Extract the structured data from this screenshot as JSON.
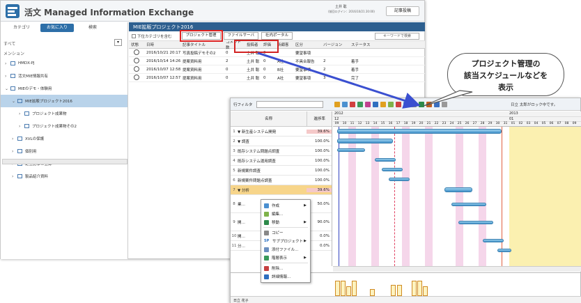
{
  "app": {
    "title": "活文 Managed Information Exchange",
    "user": "土井 聡",
    "login_info": "(前回ログイン：2016/10/21 20:00)",
    "post_button": "記事投稿"
  },
  "sidebar": {
    "tabs": [
      "カテゴリ",
      "お気に入り",
      "検索"
    ],
    "active_tab": 1,
    "filter": "すべて",
    "section": "メンション",
    "items": [
      {
        "label": "HMDX-PJ",
        "indent": 0,
        "arrow": "›"
      },
      {
        "label": "活文MIE情報共有",
        "indent": 0,
        "arrow": "›"
      },
      {
        "label": "MIEのデモ・体験用",
        "indent": 0,
        "arrow": "⌄"
      },
      {
        "label": "MIE拡販プロジェクト2016",
        "indent": 1,
        "arrow": "⌄"
      },
      {
        "label": "プロジェクト成果物",
        "indent": 2,
        "arrow": "›"
      },
      {
        "label": "プロジェクト成果物その2",
        "indent": 2,
        "arrow": "›"
      },
      {
        "label": "XVLの保護",
        "indent": 1,
        "arrow": "›"
      },
      {
        "label": "個別用",
        "indent": 1,
        "arrow": "›"
      },
      {
        "label": "定型記事の登録",
        "indent": 1,
        "arrow": "›"
      },
      {
        "label": "製品紹介資料",
        "indent": 1,
        "arrow": "›"
      }
    ],
    "selected": 3
  },
  "content": {
    "project_title": "MIE拡販プロジェクト2016",
    "include_sub": "下位カテゴリを含む",
    "buttons": [
      "プロジェクト管理",
      "ファイルサーバ",
      "社内ポータル"
    ],
    "search_placeholder": "キーワードで検索",
    "columns": [
      "状態",
      "日時",
      "記事タイトル",
      "コメント数",
      "投稿者",
      "評価",
      "新顧客",
      "区分",
      "バージョン",
      "ステータス"
    ],
    "rows": [
      [
        "2016/10/21 20:17",
        "写真投稿デモその2",
        "0",
        "土井 聡",
        "0",
        "",
        "要望事項",
        "",
        ""
      ],
      [
        "2016/10/14 14:26",
        "提案資料用",
        "2",
        "土井 聡",
        "0",
        "A社",
        "不具合報告",
        "2",
        "着手"
      ],
      [
        "2016/10/07 12:58",
        "提案資料用",
        "0",
        "土井 聡",
        "0",
        "B社",
        "要望事項",
        "2",
        "着手"
      ],
      [
        "2016/10/07 12:57",
        "提案資料用",
        "0",
        "土井 聡",
        "0",
        "A社",
        "要望事項",
        "3",
        "完了"
      ]
    ]
  },
  "callout": {
    "lines": [
      "プロジェクト管理の",
      "該当スケジュールなどを",
      "表示"
    ]
  },
  "gantt": {
    "filter_label": "行フィルタ",
    "lock_text": "日立 太郎がロック中です。",
    "col_name": "名称",
    "col_rate": "進捗率",
    "year1": "2012",
    "year2": "2013",
    "month1": "12",
    "month2": "01",
    "days": [
      "09",
      "10",
      "11",
      "12",
      "13",
      "14",
      "15",
      "16",
      "17",
      "18",
      "19",
      "20",
      "21",
      "22",
      "23",
      "24",
      "25",
      "26",
      "27",
      "28",
      "29",
      "30",
      "31",
      "01",
      "02",
      "03",
      "04",
      "05",
      "06",
      "07",
      "08",
      "09"
    ],
    "rows": [
      {
        "num": "1",
        "name": "▼ 新生産システム開発",
        "rate": "39.6%",
        "parent": true
      },
      {
        "num": "2",
        "name": "▼ 調査",
        "rate": "100.0%",
        "parent": false
      },
      {
        "num": "3",
        "name": "既存システム問題点調査",
        "rate": "100.0%",
        "parent": false
      },
      {
        "num": "4",
        "name": "既存システム運用調査",
        "rate": "100.0%",
        "parent": false
      },
      {
        "num": "5",
        "name": "新規案件調査",
        "rate": "100.0%",
        "parent": false
      },
      {
        "num": "6",
        "name": "新規案件問題点調査",
        "rate": "100.0%",
        "parent": false
      },
      {
        "num": "7",
        "name": "▼ 分析",
        "rate": "39.6%",
        "parent": true
      },
      {
        "num": "8",
        "name": "業…",
        "rate": "50.0%",
        "parent": false
      },
      {
        "num": "9",
        "name": "開…",
        "rate": "90.0%",
        "parent": false
      },
      {
        "num": "10",
        "name": "開…",
        "rate": "0.0%",
        "parent": false
      },
      {
        "num": "11",
        "name": "分…",
        "rate": "0.0%",
        "parent": false
      }
    ],
    "footer_user": "日立 花子"
  },
  "context_menu": {
    "items": [
      {
        "label": "作成",
        "icon_color": "#4a8fd0",
        "submenu": true
      },
      {
        "label": "編集...",
        "icon_color": "#7fb24a",
        "submenu": false
      },
      {
        "label": "移動",
        "icon_color": "#2d8a4a",
        "submenu": true
      },
      {
        "label": "コピー",
        "icon_color": "#888888",
        "submenu": false
      },
      {
        "label": "サブプロジェクト",
        "icon_color": "#2a6fc0",
        "submenu": true,
        "prefix": "SP"
      },
      {
        "label": "添付ファイル...",
        "icon_color": "#6b8fbf",
        "submenu": false
      },
      {
        "label": "階層表示",
        "icon_color": "#3a9a5a",
        "submenu": true
      },
      {
        "label": "削除...",
        "icon_color": "#c64040",
        "submenu": false
      },
      {
        "label": "詳細情報...",
        "icon_color": "#2d6fc0",
        "submenu": false
      }
    ]
  },
  "colors": {
    "header_blue": "#2d5f8f",
    "accent_red": "#d22222",
    "arrow_blue": "#3a4fd0",
    "gantt_bar": "#3f90c8"
  }
}
